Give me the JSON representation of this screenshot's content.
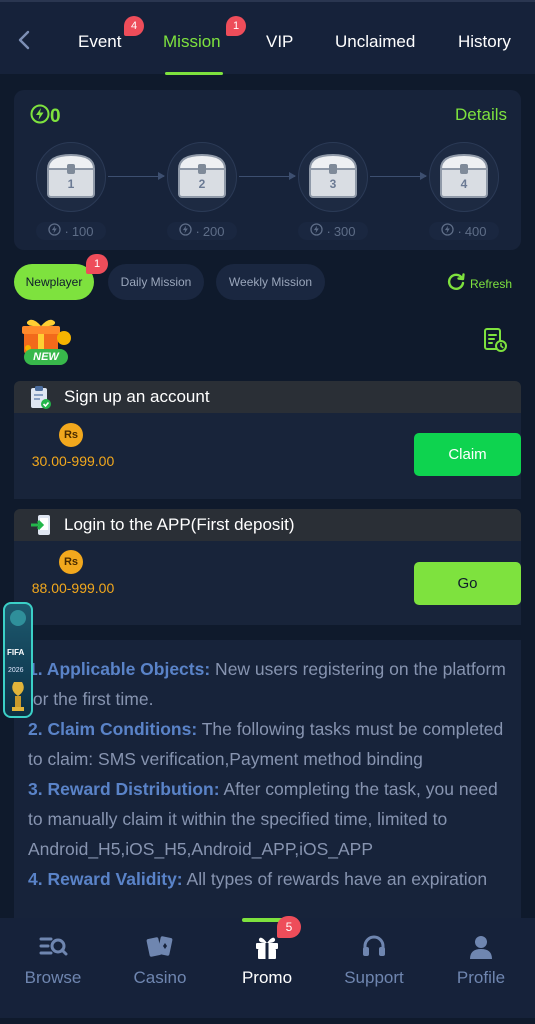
{
  "header": {
    "tabs": [
      {
        "label": "Event",
        "badge": "4"
      },
      {
        "label": "Mission",
        "badge": "1",
        "active": true
      },
      {
        "label": "VIP"
      },
      {
        "label": "Unclaimed"
      },
      {
        "label": "History"
      }
    ]
  },
  "chest_panel": {
    "points": "0",
    "details_label": "Details",
    "chests": [
      {
        "number": "1",
        "requirement": "100"
      },
      {
        "number": "2",
        "requirement": "200"
      },
      {
        "number": "3",
        "requirement": "300"
      },
      {
        "number": "4",
        "requirement": "400"
      }
    ]
  },
  "filters": {
    "items": [
      {
        "label": "Newplayer",
        "active": true
      },
      {
        "label": "Daily Mission"
      },
      {
        "label": "Weekly Mission"
      }
    ],
    "newplayer_badge": "1",
    "refresh_label": "Refresh"
  },
  "banner": {
    "new_label": "NEW"
  },
  "tasks": [
    {
      "title": "Sign up an account",
      "currency": "Rs",
      "reward": "30.00-999.00",
      "button": "Claim"
    },
    {
      "title": "Login to the APP(First deposit)",
      "currency": "Rs",
      "reward": "88.00-999.00",
      "button": "Go"
    }
  ],
  "rules": [
    {
      "heading": "1. Applicable Objects:",
      "text": " New users registering on the platform for the first time."
    },
    {
      "heading": "2. Claim Conditions:",
      "text": " The following tasks must be completed to claim: SMS verification,Payment method binding"
    },
    {
      "heading": "3. Reward Distribution:",
      "text": " After completing the task, you need to manually claim it within the specified time, limited to Android_H5,iOS_H5,Android_APP,iOS_APP"
    },
    {
      "heading": "4. Reward Validity:",
      "text": " All types of rewards have an expiration"
    }
  ],
  "floating_promo": {
    "title": "FIFA",
    "year": "2026"
  },
  "bottom_nav": {
    "items": [
      {
        "label": "Browse"
      },
      {
        "label": "Casino"
      },
      {
        "label": "Promo",
        "active": true
      },
      {
        "label": "Support"
      },
      {
        "label": "Profile"
      }
    ],
    "promo_badge": "5"
  },
  "colors": {
    "accent": "#7ee23e",
    "badge": "#ee4d5a",
    "coin": "#f2a81d",
    "claim": "#0ed34f"
  }
}
